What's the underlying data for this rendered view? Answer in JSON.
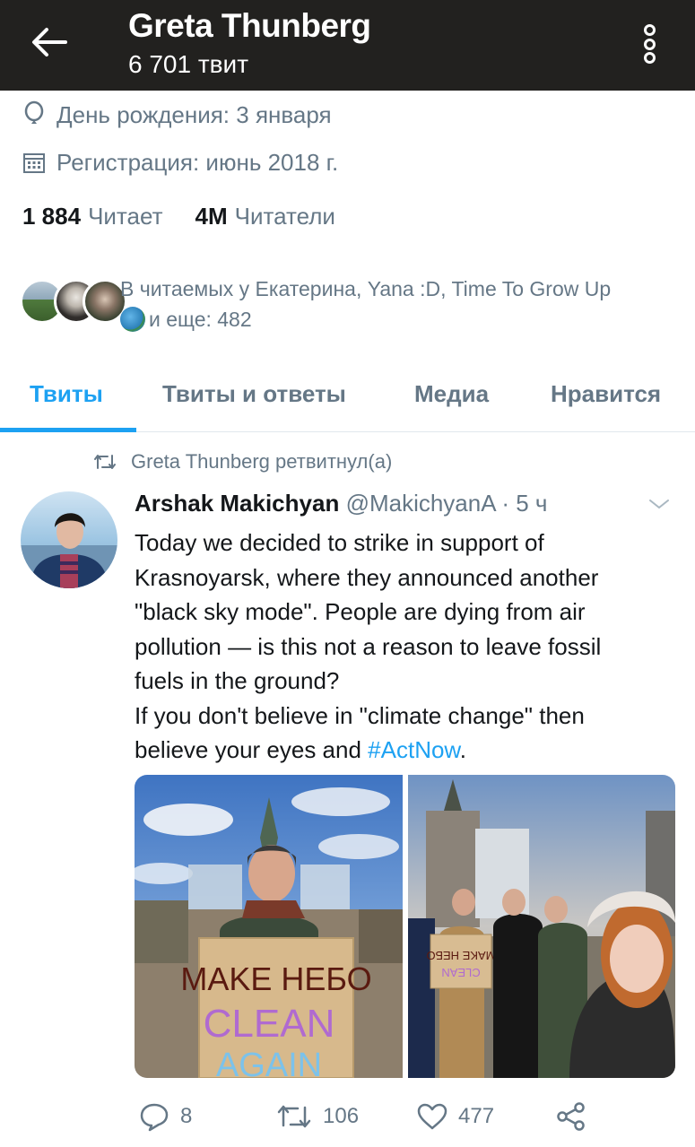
{
  "header": {
    "title": "Greta Thunberg",
    "subtitle": "6 701 твит",
    "back_icon": "arrow-left-icon",
    "more_icon": "more-vertical-icon"
  },
  "profile": {
    "birthday": "День рождения: 3 января",
    "joined": "Регистрация: июнь 2018 г.",
    "following_count": "1 884",
    "following_label": "Читает",
    "followers_count": "4M",
    "followers_label": "Читатели",
    "followed_by_line1": "В читаемых у Екатерина, Yana :D, Time To Grow Up",
    "followed_by_line2": "и еще: 482"
  },
  "tabs": [
    {
      "label": "Твиты",
      "active": true
    },
    {
      "label": "Твиты и ответы",
      "active": false
    },
    {
      "label": "Медиа",
      "active": false
    },
    {
      "label": "Нравится",
      "active": false
    }
  ],
  "tweet": {
    "retweet_text": "Greta Thunberg ретвитнул(а)",
    "author_name": "Arshak Makichyan",
    "author_handle": "@MakichyanA · 5 ч",
    "lines": [
      "Today we decided to strike in support of",
      "Krasnoyarsk, where they announced another",
      "\"black sky mode\". People are dying from air",
      "pollution — is this not a reason to leave fossil",
      "fuels in the ground?",
      "If you don't believe in \"climate change\" then"
    ],
    "last_line_prefix": "believe your eyes and ",
    "hashtag": "#ActNow",
    "last_line_suffix": ".",
    "sign_line1": "MAKE НЕБО",
    "sign_line2": "CLEAN",
    "sign_line3": "AGAIN",
    "small_sign_line1": "MAKE НЕБО",
    "small_sign_line2": "CLEAN",
    "replies": "8",
    "retweets": "106",
    "likes": "477"
  },
  "colors": {
    "accent": "#1da1f2",
    "header_bg": "#22211f",
    "muted": "#657786"
  }
}
